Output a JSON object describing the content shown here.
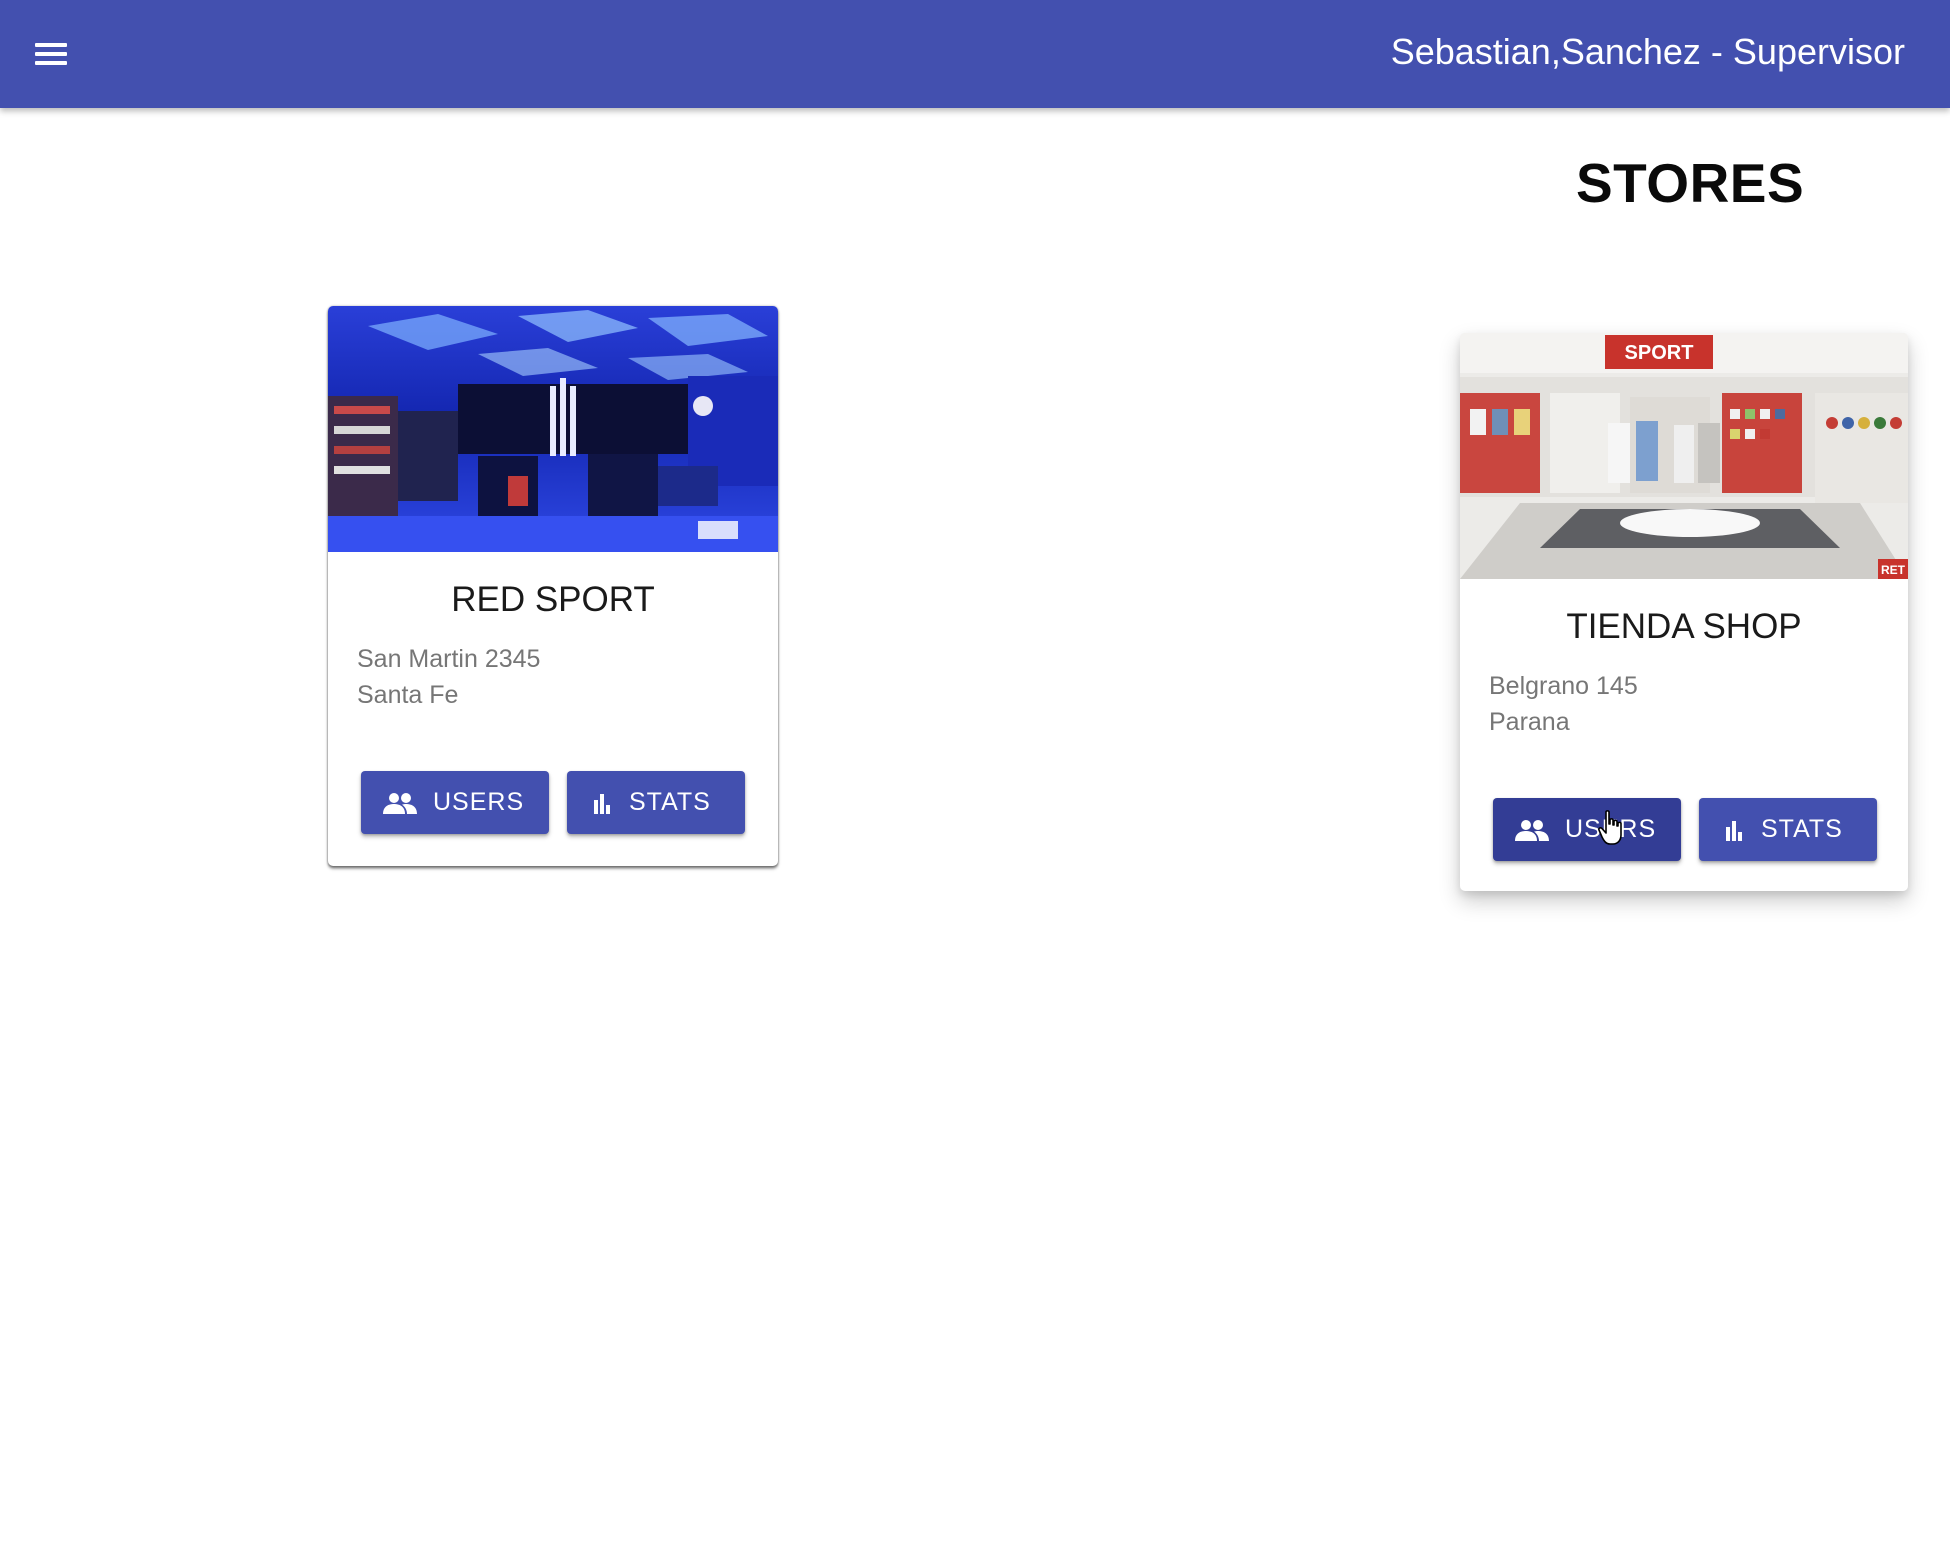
{
  "header": {
    "menu_icon": "hamburger-menu-icon",
    "user_label": "Sebastian,Sanchez - Supervisor",
    "background_color": "#4350af"
  },
  "page": {
    "title": "STORES"
  },
  "stores": [
    {
      "name": "RED SPORT",
      "address_line1": "San Martin 2345",
      "address_line2": "Santa Fe",
      "image": "store-interior-blue-lit",
      "users_label": "USERS",
      "stats_label": "STATS"
    },
    {
      "name": "TIENDA SHOP",
      "address_line1": "Belgrano 145",
      "address_line2": "Parana",
      "image": "store-interior-sport-sign",
      "users_label": "USERS",
      "stats_label": "STATS"
    }
  ],
  "icons": {
    "users": "people-icon",
    "stats": "bar-chart-icon"
  },
  "colors": {
    "button": "#4350af",
    "button_hover": "#333d95",
    "address_text": "#767676"
  },
  "image_texts": {
    "store2_sign": "SPORT",
    "store2_corner_tag": "RET"
  }
}
